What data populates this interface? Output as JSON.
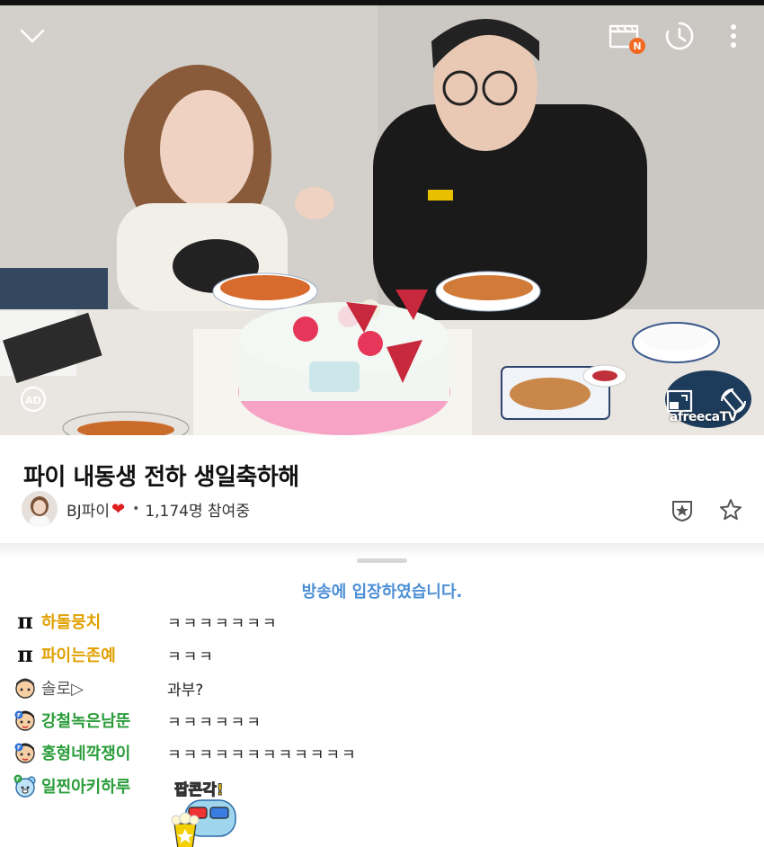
{
  "player": {
    "icons": {
      "collapse": "chevron-down-icon",
      "vod": "clapperboard-icon",
      "vod_badge": "N",
      "timer": "clock-icon",
      "more": "more-vertical-icon",
      "ad": "AD",
      "resize": "pip-icon",
      "rotate": "rotate-icon"
    },
    "watermark": "afreecaTV"
  },
  "stream": {
    "title": "파이 내동생 전하 생일축하해",
    "bj_name": "BJ파이",
    "heart": "❤",
    "dot": "•",
    "viewers": "1,174명 참여중"
  },
  "chat": {
    "system_message": "방송에 입장하였습니다.",
    "messages": [
      {
        "icon": "pi-icon",
        "nickname": "하돌뭉치",
        "nick_color": "#e0a000",
        "text": "ㅋㅋㅋㅋㅋㅋㅋ"
      },
      {
        "icon": "pi-icon",
        "nickname": "파이는존예",
        "nick_color": "#e0a000",
        "text": "ㅋㅋㅋ"
      },
      {
        "icon": "user-face-icon",
        "nickname": "솔로▷",
        "nick_color": "#555555",
        "text": "과부?"
      },
      {
        "icon": "fan-face-icon",
        "nickname": "강철녹은남뚠",
        "nick_color": "#2a9d3a",
        "text": "ㅋㅋㅋㅋㅋㅋ"
      },
      {
        "icon": "fan-face-icon",
        "nickname": "홍형네깍쟁이",
        "nick_color": "#2a9d3a",
        "text": "ㅋㅋㅋㅋㅋㅋㅋㅋㅋㅋㅋㅋ"
      },
      {
        "icon": "bear-fan-icon",
        "nickname": "일찐아키하루",
        "nick_color": "#2a9d3a",
        "text": ""
      }
    ],
    "sticker_text": "팝콘각!"
  }
}
